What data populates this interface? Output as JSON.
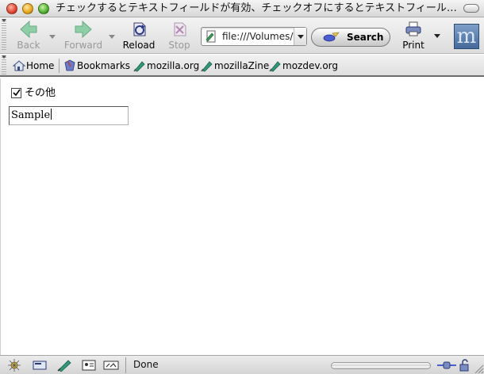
{
  "window": {
    "title": "チェックするとテキストフィールドが有効、チェックオフにするとテキストフィール…"
  },
  "toolbar": {
    "back_label": "Back",
    "forward_label": "Forward",
    "reload_label": "Reload",
    "stop_label": "Stop",
    "print_label": "Print",
    "search_label": "Search",
    "url_value": "file:///Volumes/"
  },
  "bookmarks": {
    "home_label": "Home",
    "bookmarks_label": "Bookmarks",
    "items": [
      "mozilla.org",
      "mozillaZine",
      "mozdev.org"
    ]
  },
  "content": {
    "checkbox_label": "その他",
    "checkbox_checked": true,
    "textfield_value": "Sample"
  },
  "status": {
    "text": "Done"
  },
  "colors": {
    "link_green": "#2f9a7a",
    "logo_blue": "#456a9b"
  }
}
